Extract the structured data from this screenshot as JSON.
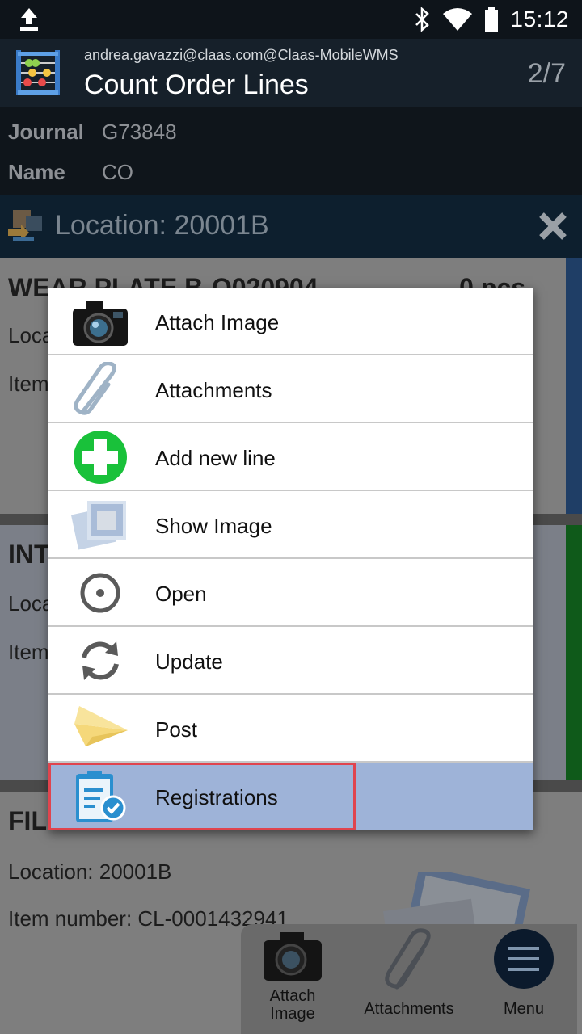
{
  "status_bar": {
    "time": "15:12"
  },
  "header": {
    "user": "andrea.gavazzi@claas.com@Claas-MobileWMS",
    "title": "Count Order Lines",
    "pager": "2/7"
  },
  "journal": {
    "journal_label": "Journal",
    "journal_value": "G73848",
    "name_label": "Name",
    "name_value": "CO"
  },
  "location_bar": {
    "text": "Location: 20001B"
  },
  "cards": [
    {
      "title": "WEAR PLATE B-Q020904",
      "qty": "0 pcs",
      "line1": "Loca",
      "line2": "Item"
    },
    {
      "title": "INT",
      "line1": "Loca",
      "line2": "Item"
    },
    {
      "title": "FIL",
      "qty": "'",
      "line1": "Location: 20001B",
      "line2": "Item number: CL-0001432941"
    }
  ],
  "menu": {
    "items": [
      {
        "label": "Attach Image",
        "icon": "camera-icon"
      },
      {
        "label": "Attachments",
        "icon": "paperclip-icon"
      },
      {
        "label": "Add new line",
        "icon": "plus-circle-icon"
      },
      {
        "label": "Show Image",
        "icon": "image-icon"
      },
      {
        "label": "Open",
        "icon": "radio-target-icon"
      },
      {
        "label": "Update",
        "icon": "refresh-icon"
      },
      {
        "label": "Post",
        "icon": "paper-plane-icon"
      },
      {
        "label": "Registrations",
        "icon": "clipboard-check-icon",
        "selected": true
      }
    ]
  },
  "bottom_bar": {
    "attach_image": "Attach\nImage",
    "attachments": "Attachments",
    "menu": "Menu"
  },
  "colors": {
    "selected_bg": "#9eb3d8",
    "highlight_border": "#e0444e",
    "add_green": "#19c13a"
  }
}
